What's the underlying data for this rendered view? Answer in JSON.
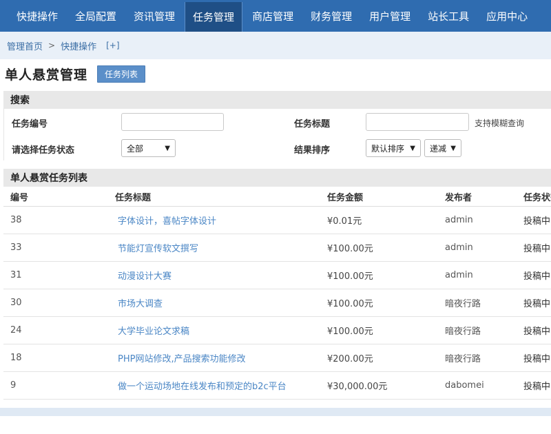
{
  "nav": {
    "items": [
      {
        "label": "快捷操作"
      },
      {
        "label": "全局配置"
      },
      {
        "label": "资讯管理"
      },
      {
        "label": "任务管理"
      },
      {
        "label": "商店管理"
      },
      {
        "label": "财务管理"
      },
      {
        "label": "用户管理"
      },
      {
        "label": "站长工具"
      },
      {
        "label": "应用中心"
      }
    ],
    "active_index": 3
  },
  "breadcrumb": {
    "home": "管理首页",
    "separator": ">",
    "current": "快捷操作",
    "add": "[+]"
  },
  "page": {
    "title": "单人悬赏管理",
    "list_button": "任务列表"
  },
  "search": {
    "heading": "搜索",
    "task_id_label": "任务编号",
    "task_id_value": "",
    "task_title_label": "任务标题",
    "task_title_value": "",
    "fuzzy_hint": "支持模糊查询",
    "status_label": "请选择任务状态",
    "status_selected": "全部",
    "sort_label": "结果排序",
    "sort_selected": "默认排序",
    "order_selected": "递减"
  },
  "table": {
    "heading": "单人悬赏任务列表",
    "columns": {
      "id": "编号",
      "title": "任务标题",
      "amount": "任务金额",
      "publisher": "发布者",
      "status": "任务状态"
    },
    "rows": [
      {
        "id": "38",
        "title": "字体设计，喜帖字体设计",
        "amount": "¥0.01元",
        "publisher": "admin",
        "status": "投稿中"
      },
      {
        "id": "33",
        "title": "节能灯宣传软文撰写",
        "amount": "¥100.00元",
        "publisher": "admin",
        "status": "投稿中"
      },
      {
        "id": "31",
        "title": "动漫设计大赛",
        "amount": "¥100.00元",
        "publisher": "admin",
        "status": "投稿中"
      },
      {
        "id": "30",
        "title": "市场大调查",
        "amount": "¥100.00元",
        "publisher": "暗夜行路",
        "status": "投稿中"
      },
      {
        "id": "24",
        "title": "大学毕业论文求稿",
        "amount": "¥100.00元",
        "publisher": "暗夜行路",
        "status": "投稿中"
      },
      {
        "id": "18",
        "title": "PHP网站修改,产品搜索功能修改",
        "amount": "¥200.00元",
        "publisher": "暗夜行路",
        "status": "投稿中"
      },
      {
        "id": "9",
        "title": "做一个运动场地在线发布和预定的b2c平台",
        "amount": "¥30,000.00元",
        "publisher": "dabomei",
        "status": "投稿中"
      }
    ]
  }
}
